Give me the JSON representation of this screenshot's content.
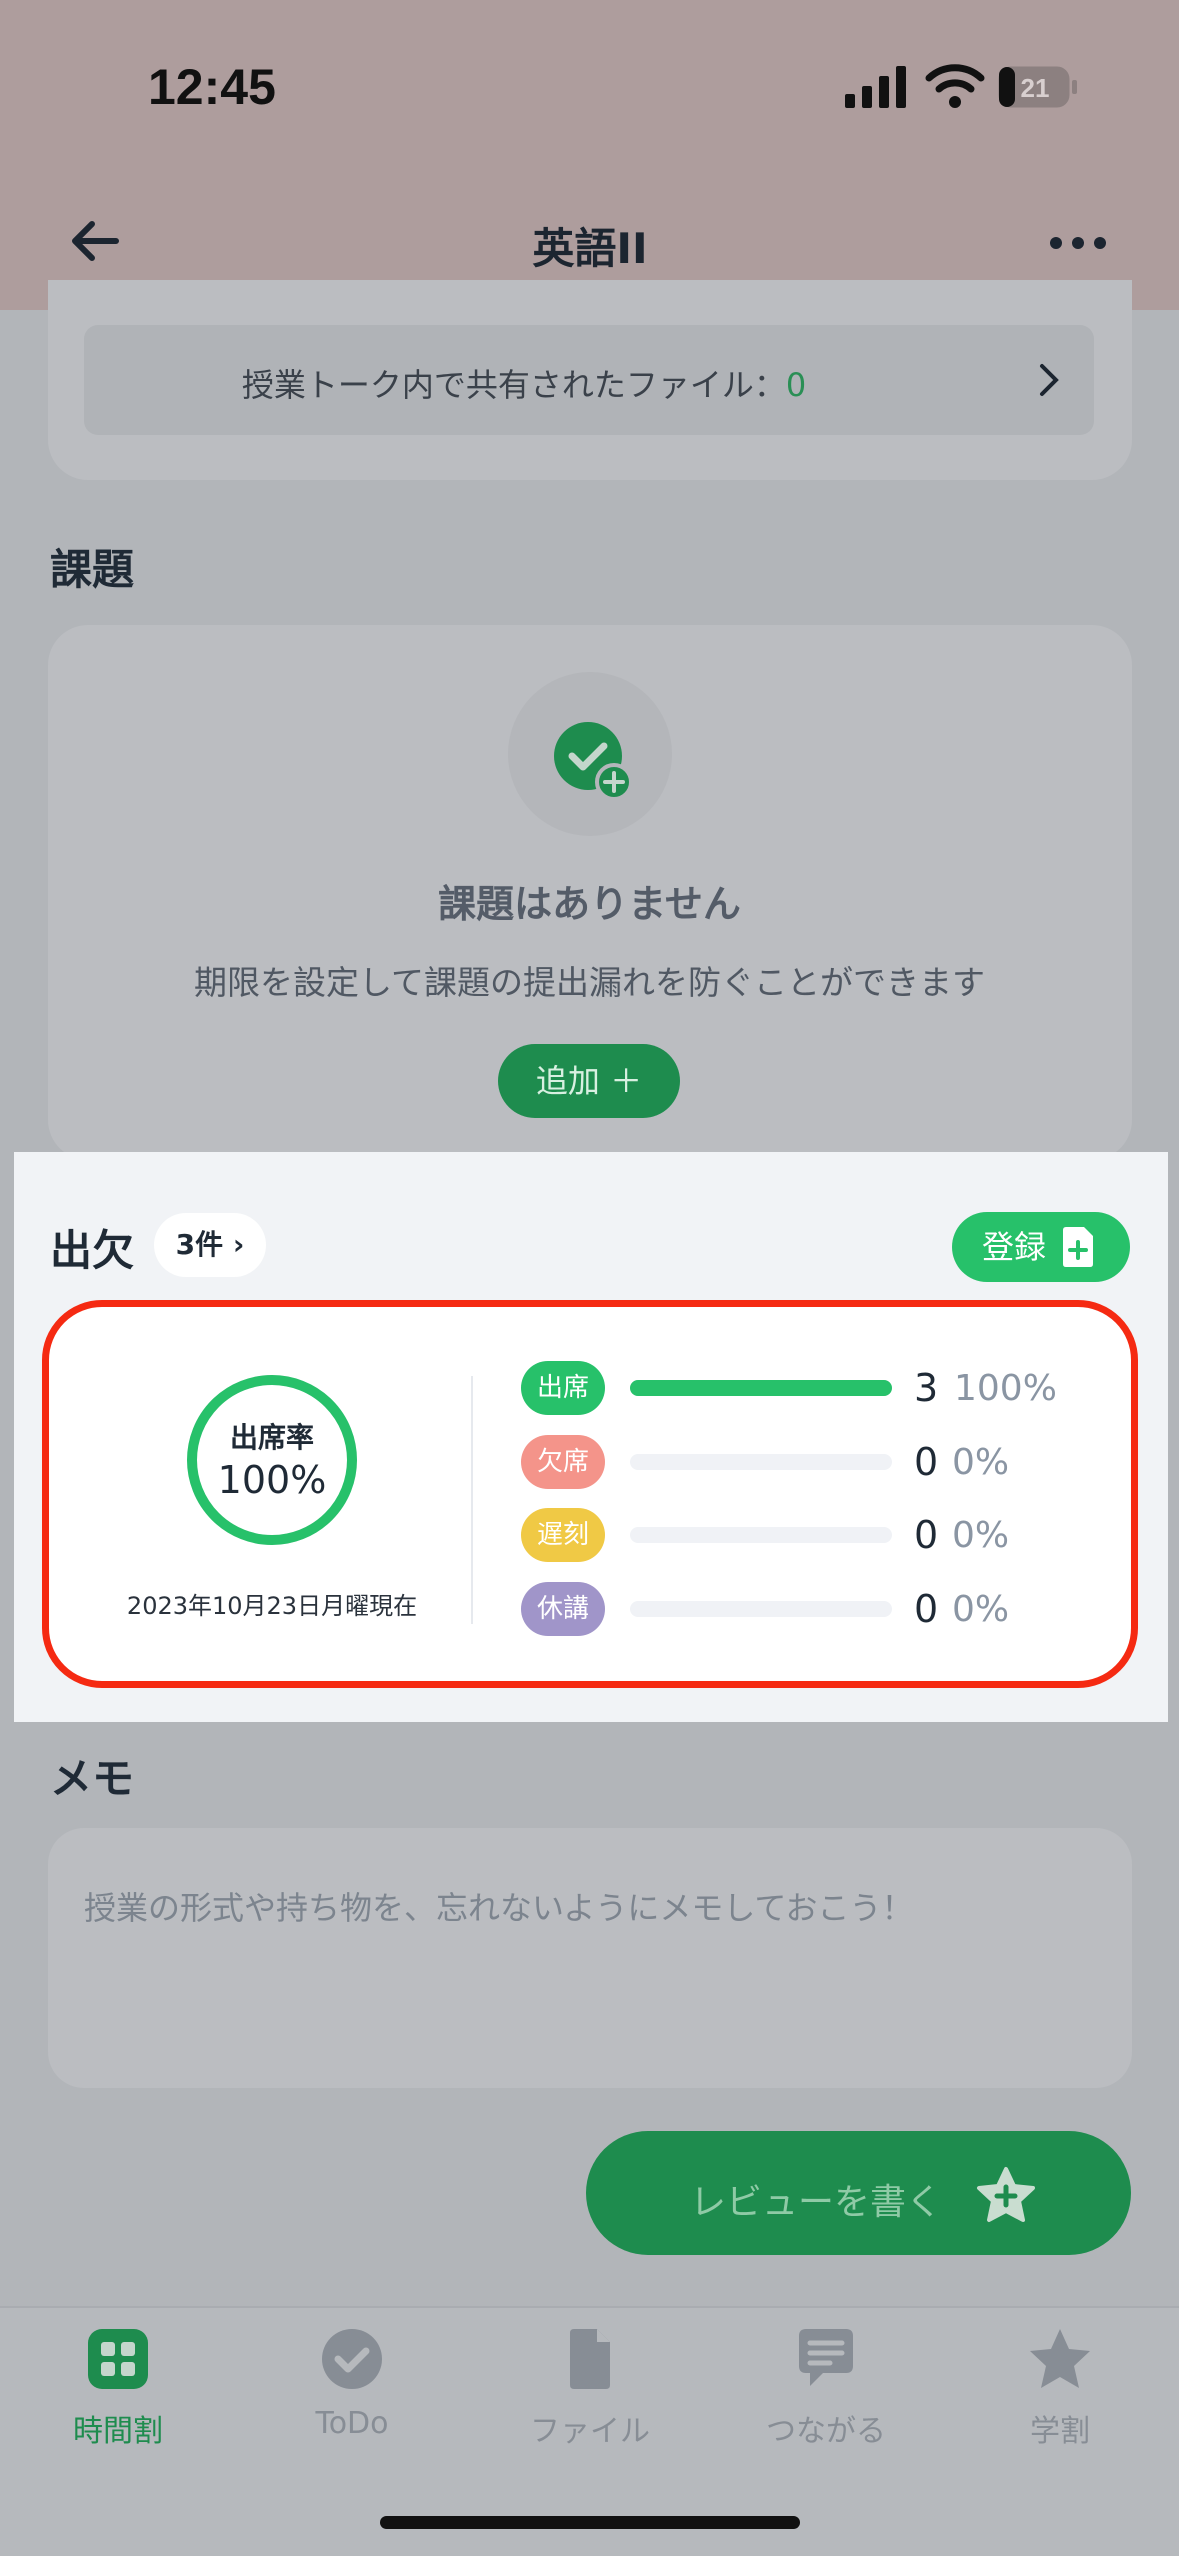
{
  "status_bar": {
    "time": "12:45",
    "battery": "21"
  },
  "header": {
    "title": "英語II"
  },
  "files": {
    "label": "授業トーク内で共有されたファイル：",
    "count": "0"
  },
  "tasks": {
    "section_title": "課題",
    "empty_title": "課題はありません",
    "empty_desc": "期限を設定して課題の提出漏れを防ぐことができます",
    "add_label": "追加 ＋"
  },
  "attendance": {
    "section_title": "出欠",
    "count_label": "3件 ›",
    "register_label": "登録",
    "rate_label": "出席率",
    "rate_value": "100%",
    "rate_fraction": 1.0,
    "as_of": "2023年10月23日月曜現在",
    "rows": [
      {
        "label": "出席",
        "count": "3",
        "percent": "100%",
        "fraction": 1.0,
        "color": "#27c16a"
      },
      {
        "label": "欠席",
        "count": "0",
        "percent": "0%",
        "fraction": 0,
        "color": "#f4948a"
      },
      {
        "label": "遅刻",
        "count": "0",
        "percent": "0%",
        "fraction": 0,
        "color": "#f0c945"
      },
      {
        "label": "休講",
        "count": "0",
        "percent": "0%",
        "fraction": 0,
        "color": "#a095c9"
      }
    ]
  },
  "memo": {
    "section_title": "メモ",
    "placeholder": "授業の形式や持ち物を、忘れないようにメモしておこう！"
  },
  "review_button": {
    "label": "レビューを書く"
  },
  "tabs": [
    {
      "label": "時間割",
      "icon": "timetable-icon",
      "active": true
    },
    {
      "label": "ToDo",
      "icon": "check-icon",
      "active": false
    },
    {
      "label": "ファイル",
      "icon": "file-icon",
      "active": false
    },
    {
      "label": "つながる",
      "icon": "chat-icon",
      "active": false
    },
    {
      "label": "学割",
      "icon": "star-icon",
      "active": false
    }
  ],
  "colors": {
    "accent": "#27c16a",
    "highlight": "#f52a12",
    "header": "#ae9d9d"
  }
}
